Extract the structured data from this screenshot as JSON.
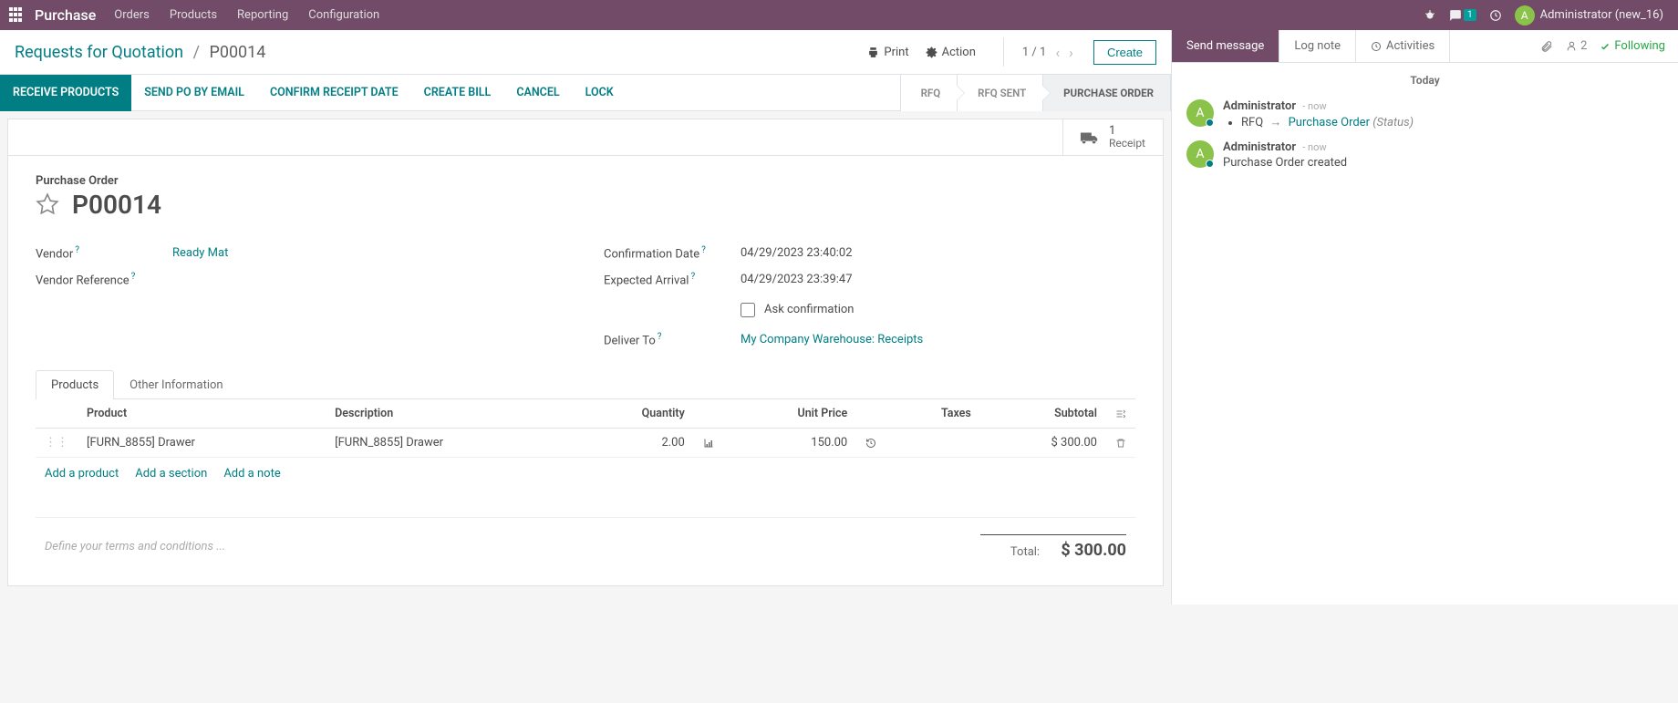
{
  "topnav": {
    "brand": "Purchase",
    "menu": [
      "Orders",
      "Products",
      "Reporting",
      "Configuration"
    ],
    "msg_badge": "1",
    "avatar_letter": "A",
    "username": "Administrator (new_16)"
  },
  "control": {
    "breadcrumb_root": "Requests for Quotation",
    "breadcrumb_current": "P00014",
    "print": "Print",
    "action": "Action",
    "pager": "1 / 1",
    "create": "Create"
  },
  "statusbar": {
    "actions": [
      "RECEIVE PRODUCTS",
      "SEND PO BY EMAIL",
      "CONFIRM RECEIPT DATE",
      "CREATE BILL",
      "CANCEL",
      "LOCK"
    ],
    "steps": [
      "RFQ",
      "RFQ SENT",
      "PURCHASE ORDER"
    ]
  },
  "buttonbox": {
    "receipt_count": "1",
    "receipt_label": "Receipt"
  },
  "form": {
    "heading": "Purchase Order",
    "doc_number": "P00014",
    "vendor_label": "Vendor",
    "vendor_value": "Ready Mat",
    "vendor_ref_label": "Vendor Reference",
    "confirm_date_label": "Confirmation Date",
    "confirm_date_value": "04/29/2023 23:40:02",
    "expected_label": "Expected Arrival",
    "expected_value": "04/29/2023 23:39:47",
    "ask_confirm": "Ask confirmation",
    "deliver_label": "Deliver To",
    "deliver_value": "My Company Warehouse: Receipts"
  },
  "tabs": {
    "products": "Products",
    "other": "Other Information"
  },
  "table": {
    "headers": {
      "product": "Product",
      "desc": "Description",
      "qty": "Quantity",
      "price": "Unit Price",
      "taxes": "Taxes",
      "subtotal": "Subtotal"
    },
    "row": {
      "product": "[FURN_8855] Drawer",
      "desc": "[FURN_8855] Drawer",
      "qty": "2.00",
      "price": "150.00",
      "taxes": "",
      "subtotal": "$ 300.00"
    },
    "add_product": "Add a product",
    "add_section": "Add a section",
    "add_note": "Add a note",
    "terms_placeholder": "Define your terms and conditions ...",
    "total_label": "Total:",
    "total_value": "$ 300.00"
  },
  "chatter": {
    "send": "Send message",
    "log": "Log note",
    "activities": "Activities",
    "followers": "2",
    "following": "Following",
    "today": "Today",
    "msg1": {
      "author": "Administrator",
      "time": "- now",
      "field": "RFQ",
      "to": "Purchase Order",
      "status": "(Status)"
    },
    "msg2": {
      "author": "Administrator",
      "time": "- now",
      "text": "Purchase Order created"
    }
  }
}
